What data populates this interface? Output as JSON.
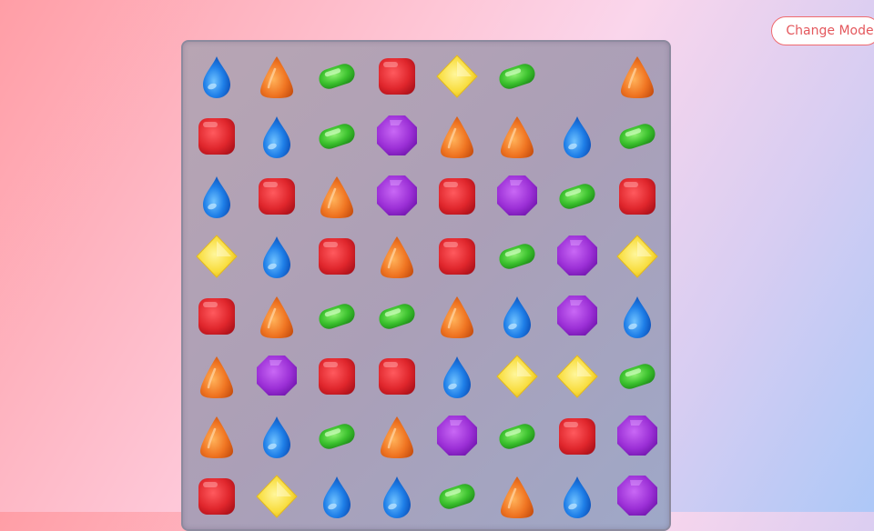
{
  "header": {
    "change_mode_label": "Change Mode"
  },
  "board": {
    "rows": 8,
    "cols": 8,
    "grid": [
      [
        "blue",
        "orange",
        "green",
        "red",
        "yellow",
        "green",
        "empty",
        "orange"
      ],
      [
        "red",
        "blue",
        "green",
        "purple",
        "orange",
        "orange",
        "blue",
        "green"
      ],
      [
        "blue",
        "red",
        "orange",
        "purple",
        "red",
        "purple",
        "green",
        "red"
      ],
      [
        "yellow",
        "blue",
        "red",
        "orange",
        "red",
        "green",
        "purple",
        "yellow"
      ],
      [
        "red",
        "orange",
        "green",
        "green",
        "orange",
        "blue",
        "purple",
        "blue"
      ],
      [
        "orange",
        "purple",
        "red",
        "red",
        "blue",
        "yellow",
        "yellow",
        "green"
      ],
      [
        "orange",
        "blue",
        "green",
        "orange",
        "purple",
        "green",
        "red",
        "purple"
      ],
      [
        "red",
        "yellow",
        "blue",
        "blue",
        "green",
        "orange",
        "blue",
        "purple"
      ]
    ]
  },
  "candy_types": {
    "blue": {
      "icon": "blue-drop-candy-icon",
      "color": "#1f7fe8"
    },
    "orange": {
      "icon": "orange-cone-candy-icon",
      "color": "#f07522"
    },
    "green": {
      "icon": "green-jellybean-candy-icon",
      "color": "#3cc22e"
    },
    "red": {
      "icon": "red-square-candy-icon",
      "color": "#e0262c"
    },
    "yellow": {
      "icon": "yellow-diamond-candy-icon",
      "color": "#f8dc3a"
    },
    "purple": {
      "icon": "purple-octagon-candy-icon",
      "color": "#9b2fd6"
    }
  },
  "colors": {
    "accent": "#ef6b6f"
  }
}
